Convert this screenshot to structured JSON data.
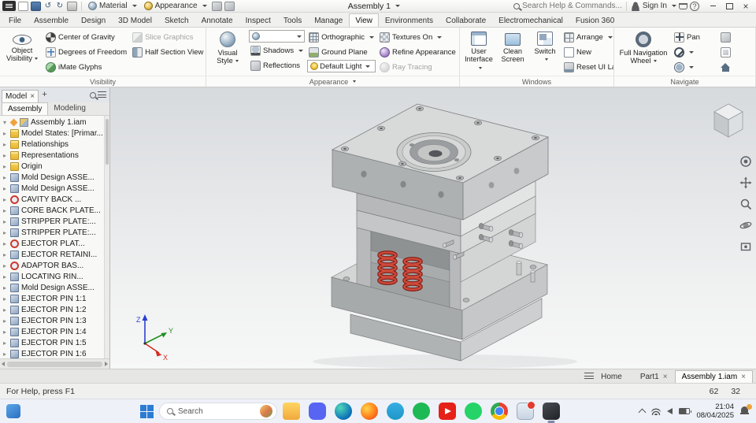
{
  "titlebar": {
    "doc_title": "Assembly 1",
    "material_label": "Material",
    "appearance_label": "Appearance",
    "search_placeholder": "Search Help & Commands...",
    "sign_in_label": "Sign In"
  },
  "ribbon": {
    "tabs": [
      {
        "label": "File"
      },
      {
        "label": "Assemble"
      },
      {
        "label": "Design"
      },
      {
        "label": "3D Model"
      },
      {
        "label": "Sketch"
      },
      {
        "label": "Annotate"
      },
      {
        "label": "Inspect"
      },
      {
        "label": "Tools"
      },
      {
        "label": "Manage"
      },
      {
        "label": "View",
        "state": "active"
      },
      {
        "label": "Environments"
      },
      {
        "label": "Collaborate"
      },
      {
        "label": "Electromechanical"
      },
      {
        "label": "Fusion 360"
      }
    ],
    "visibility": {
      "label": "Visibility",
      "object_visibility": "Object Visibility",
      "center_of_gravity": "Center of Gravity",
      "degrees_of_freedom": "Degrees of Freedom",
      "imate_glyphs": "iMate Glyphs",
      "slice_graphics": "Slice Graphics",
      "half_section_view": "Half Section View"
    },
    "appearance": {
      "label": "Appearance",
      "visual_style": "Visual Style",
      "shadows": "Shadows",
      "reflections": "Reflections",
      "orthographic": "Orthographic",
      "ground_plane": "Ground Plane",
      "default_light": "Default Light",
      "textures_on": "Textures On",
      "refine_appearance": "Refine Appearance",
      "ray_tracing": "Ray Tracing"
    },
    "windows": {
      "label": "Windows",
      "user_interface": "User Interface",
      "clean_screen": "Clean Screen",
      "switch": "Switch",
      "arrange": "Arrange",
      "new_window": "New",
      "reset_ui_layout": "Reset UI Layout"
    },
    "navigate": {
      "label": "Navigate",
      "full_navigation_wheel": "Full Navigation Wheel",
      "pan": "Pan"
    }
  },
  "browser": {
    "panel_tab": "Model",
    "subtab_assembly": "Assembly",
    "subtab_modeling": "Modeling",
    "root": {
      "label": "Assembly 1.iam"
    },
    "tree": [
      {
        "exp": "▸",
        "icon": "ic-folder",
        "label": "Model States: [Primar..."
      },
      {
        "exp": "▸",
        "icon": "ic-folder",
        "label": "Relationships"
      },
      {
        "exp": "▸",
        "icon": "ic-folder",
        "label": "Representations"
      },
      {
        "exp": "▸",
        "icon": "ic-folder",
        "label": "Origin"
      },
      {
        "exp": "▸",
        "icon": "ic-part",
        "label": "Mold Design ASSE..."
      },
      {
        "exp": "▸",
        "icon": "ic-part",
        "label": "Mold Design ASSE..."
      },
      {
        "exp": "▸",
        "icon": "ic-adaptive",
        "label": "CAVITY BACK ..."
      },
      {
        "exp": "▸",
        "icon": "ic-part",
        "label": "CORE BACK PLATE..."
      },
      {
        "exp": "▸",
        "icon": "ic-part",
        "label": "STRIPPER PLATE:..."
      },
      {
        "exp": "▸",
        "icon": "ic-part",
        "label": "STRIPPER PLATE:..."
      },
      {
        "exp": "▸",
        "icon": "ic-adaptive",
        "label": "EJECTOR PLAT..."
      },
      {
        "exp": "▸",
        "icon": "ic-part",
        "label": "EJECTOR RETAINI..."
      },
      {
        "exp": "▸",
        "icon": "ic-adaptive",
        "label": "ADAPTOR BAS..."
      },
      {
        "exp": "▸",
        "icon": "ic-part",
        "label": "LOCATING RIN..."
      },
      {
        "exp": "▸",
        "icon": "ic-part",
        "label": "Mold Design ASSE..."
      },
      {
        "exp": "▸",
        "icon": "ic-part",
        "label": "EJECTOR PIN 1:1"
      },
      {
        "exp": "▸",
        "icon": "ic-part",
        "label": "EJECTOR PIN 1:2"
      },
      {
        "exp": "▸",
        "icon": "ic-part",
        "label": "EJECTOR PIN 1:3"
      },
      {
        "exp": "▸",
        "icon": "ic-part",
        "label": "EJECTOR PIN 1:4"
      },
      {
        "exp": "▸",
        "icon": "ic-part",
        "label": "EJECTOR PIN 1:5"
      },
      {
        "exp": "▸",
        "icon": "ic-part",
        "label": "EJECTOR PIN 1:6"
      }
    ]
  },
  "viewport": {
    "triad_x": "X",
    "triad_y": "Y",
    "triad_z": "Z"
  },
  "doc_tabs": [
    {
      "label": "Home",
      "close": ""
    },
    {
      "label": "Part1",
      "close": "×"
    },
    {
      "label": "Assembly 1.iam",
      "close": "×",
      "state": "active"
    }
  ],
  "statusbar": {
    "help_text": "For Help, press F1",
    "counter_a": "62",
    "counter_b": "32"
  },
  "taskbar": {
    "search_label": "Search",
    "time": "21:04",
    "date": "08/04/2025",
    "apps": [
      {
        "name": "file-explorer-icon",
        "cls": "ta-explorer"
      },
      {
        "name": "discord-icon",
        "cls": "ta-discord"
      },
      {
        "name": "edge-icon",
        "cls": "ta-edge"
      },
      {
        "name": "firefox-icon",
        "cls": "ta-firefox"
      },
      {
        "name": "telegram-icon",
        "cls": "ta-telegram"
      },
      {
        "name": "spotify-icon",
        "cls": "ta-spotify"
      },
      {
        "name": "youtube-icon",
        "cls": "ta-youtube"
      },
      {
        "name": "whatsapp-icon",
        "cls": "ta-whatsapp"
      },
      {
        "name": "chrome-icon",
        "cls": "ta-chrome"
      },
      {
        "name": "mail-icon",
        "cls": "ta-mail",
        "badge": "has-badge"
      },
      {
        "name": "inventor-icon",
        "cls": "ta-inventor",
        "state": "active-app"
      }
    ]
  }
}
